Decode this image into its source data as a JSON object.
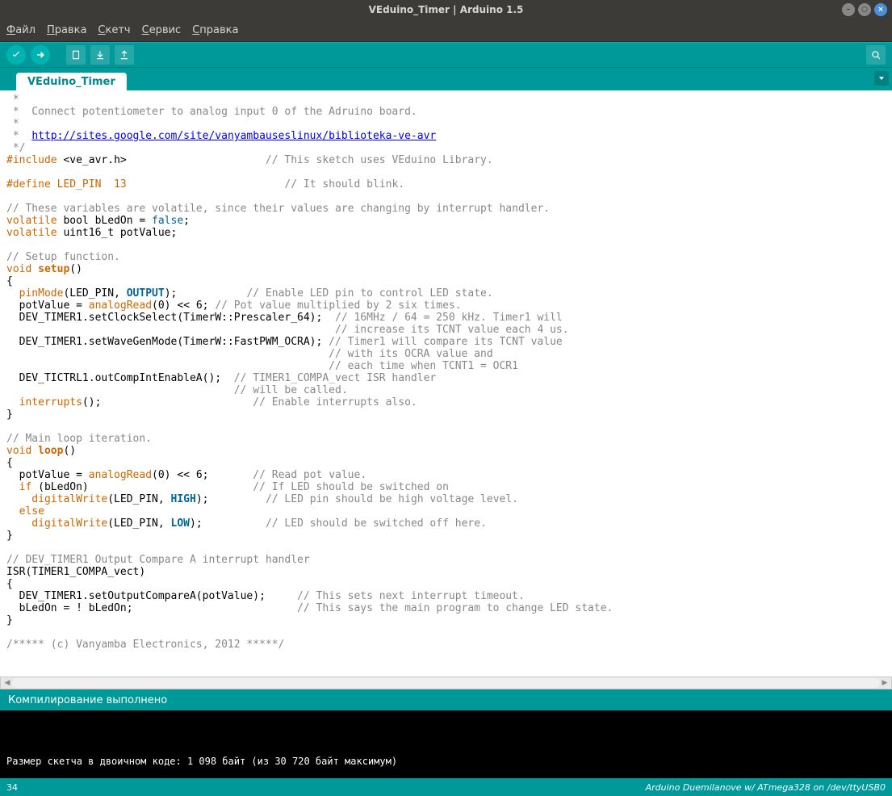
{
  "window": {
    "title": "VEduino_Timer | Arduino 1.5"
  },
  "menu": {
    "file": "Файл",
    "edit": "Правка",
    "sketch": "Скетч",
    "service": "Сервис",
    "help": "Справка"
  },
  "tab": {
    "name": "VEduino_Timer"
  },
  "code": {
    "c1": " *",
    "c2": " *  Connect potentiometer to analog input 0 of the Adruino board.",
    "c3": " *",
    "c4a": " *  ",
    "c4link": "http://sites.google.com/site/vanyambauseslinux/biblioteka-ve-avr",
    "c5": " */",
    "inc_a": "#include ",
    "inc_b": "<ve_avr.h>",
    "inc_pad": "                      ",
    "inc_c": "// This sketch uses VEduino Library.",
    "def_a": "#define LED_PIN  13",
    "def_pad": "                         ",
    "def_c": "// It should blink.",
    "vcom": "// These variables are volatile, since their values are changing by interrupt handler.",
    "v1a": "volatile",
    "v1b": " bool bLedOn = ",
    "v1c": "false",
    "v1d": ";",
    "v2a": "volatile",
    "v2b": " uint16_t potValue;",
    "scom": "// Setup function.",
    "sv": "void",
    "ssetup": "setup",
    "sp": "()",
    "ob": "{",
    "l1a": "  pinMode",
    "l1b": "(LED_PIN, ",
    "l1c": "OUTPUT",
    "l1d": ");",
    "l1pad": "           ",
    "l1e": "// Enable LED pin to control LED state.",
    "l2a": "  potValue = ",
    "l2b": "analogRead",
    "l2c": "(0) << 6; ",
    "l2d": "// Pot value multiplied by 2 six times.",
    "l3a": "  DEV_TIMER1.setClockSelect(TimerW::Prescaler_64);  ",
    "l3b": "// 16MHz / 64 = 250 kHz. Timer1 will",
    "l3c": "                                                    // increase its TCNT value each 4 us.",
    "l4a": "  DEV_TIMER1.setWaveGenMode(TimerW::FastPWM_OCRA); ",
    "l4b": "// Timer1 will compare its TCNT value",
    "l4c": "                                                   // with its OCRA value and",
    "l4d": "                                                   // each time when TCNT1 = OCR1",
    "l5a": "  DEV_TICTRL1.outCompIntEnableA();  ",
    "l5b": "// TIMER1_COMPA_vect ISR handler",
    "l5c": "                                    // will be called.",
    "l6a": "  interrupts",
    "l6b": "();",
    "l6pad": "                        ",
    "l6c": "// Enable interrupts also.",
    "cb": "}",
    "mcom": "// Main loop iteration.",
    "mv": "void",
    "mloop": "loop",
    "mp": "()",
    "m1a": "  potValue = ",
    "m1b": "analogRead",
    "m1c": "(0) << 6;",
    "m1pad": "       ",
    "m1d": "// Read pot value.",
    "m2a": "  ",
    "m2b": "if",
    "m2c": " (bLedOn)",
    "m2pad": "                          ",
    "m2d": "// If LED should be switched on",
    "m3a": "    digitalWrite",
    "m3b": "(LED_PIN, ",
    "m3c": "HIGH",
    "m3d": ");",
    "m3pad": "         ",
    "m3e": "// LED pin should be high voltage level.",
    "m4a": "  ",
    "m4b": "else",
    "m5a": "    digitalWrite",
    "m5b": "(LED_PIN, ",
    "m5c": "LOW",
    "m5d": ");",
    "m5pad": "          ",
    "m5e": "// LED should be switched off here.",
    "icom": "// DEV_TIMER1 Output Compare A interrupt handler",
    "i1": "ISR(TIMER1_COMPA_vect)",
    "i2a": "  DEV_TIMER1.setOutputCompareA(potValue);     ",
    "i2b": "// This sets next interrupt timeout.",
    "i3a": "  bLedOn = ! bLedOn;                          ",
    "i3b": "// This says the main program to change LED state.",
    "copy": "/***** (c) Vanyamba Electronics, 2012 *****/"
  },
  "status": {
    "msg": "Компилирование выполнено"
  },
  "console": {
    "line": "Размер скетча в двоичном коде: 1 098 байт (из 30 720 байт максимум)"
  },
  "footer": {
    "line": "34",
    "board": "Arduino Duemilanove w/ ATmega328 on /dev/ttyUSB0"
  }
}
